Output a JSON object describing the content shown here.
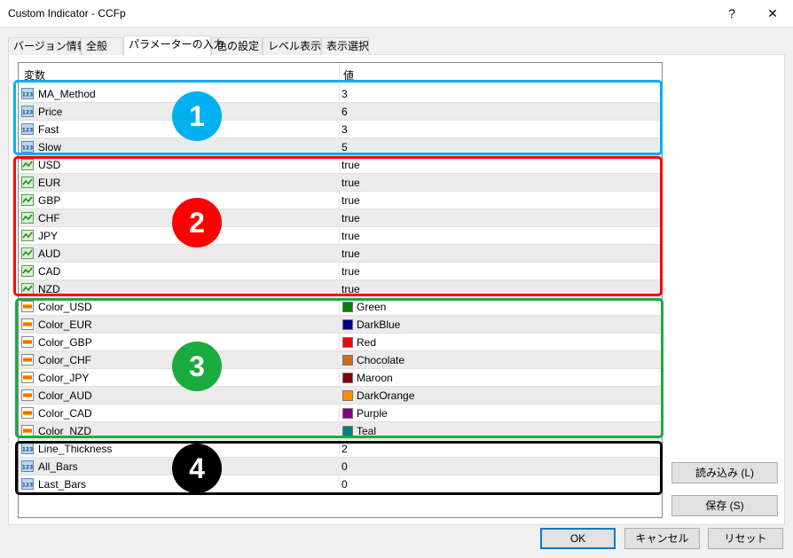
{
  "window": {
    "title": "Custom Indicator - CCFp",
    "help_label": "?",
    "close_label": "✕"
  },
  "tabs": [
    {
      "label": "バージョン情報"
    },
    {
      "label": "全般"
    },
    {
      "label": "パラメーターの入力"
    },
    {
      "label": "色の設定"
    },
    {
      "label": "レベル表示"
    },
    {
      "label": "表示選択"
    }
  ],
  "active_tab": "パラメーターの入力",
  "table": {
    "headers": {
      "variable": "変数",
      "value": "値"
    },
    "rows": [
      {
        "type": "int",
        "name": "MA_Method",
        "value": "3"
      },
      {
        "type": "int",
        "name": "Price",
        "value": "6"
      },
      {
        "type": "int",
        "name": "Fast",
        "value": "3"
      },
      {
        "type": "int",
        "name": "Slow",
        "value": "5"
      },
      {
        "type": "bool",
        "name": "USD",
        "value": "true"
      },
      {
        "type": "bool",
        "name": "EUR",
        "value": "true"
      },
      {
        "type": "bool",
        "name": "GBP",
        "value": "true"
      },
      {
        "type": "bool",
        "name": "CHF",
        "value": "true"
      },
      {
        "type": "bool",
        "name": "JPY",
        "value": "true"
      },
      {
        "type": "bool",
        "name": "AUD",
        "value": "true"
      },
      {
        "type": "bool",
        "name": "CAD",
        "value": "true"
      },
      {
        "type": "bool",
        "name": "NZD",
        "value": "true"
      },
      {
        "type": "color",
        "name": "Color_USD",
        "value": "Green",
        "swatch": "#008000"
      },
      {
        "type": "color",
        "name": "Color_EUR",
        "value": "DarkBlue",
        "swatch": "#00008b"
      },
      {
        "type": "color",
        "name": "Color_GBP",
        "value": "Red",
        "swatch": "#ff0000"
      },
      {
        "type": "color",
        "name": "Color_CHF",
        "value": "Chocolate",
        "swatch": "#d2691e"
      },
      {
        "type": "color",
        "name": "Color_JPY",
        "value": "Maroon",
        "swatch": "#800000"
      },
      {
        "type": "color",
        "name": "Color_AUD",
        "value": "DarkOrange",
        "swatch": "#ff8c00"
      },
      {
        "type": "color",
        "name": "Color_CAD",
        "value": "Purple",
        "swatch": "#800080"
      },
      {
        "type": "color",
        "name": "Color_NZD",
        "value": "Teal",
        "swatch": "#008080"
      },
      {
        "type": "int",
        "name": "Line_Thickness",
        "value": "2"
      },
      {
        "type": "int",
        "name": "All_Bars",
        "value": "0"
      },
      {
        "type": "int",
        "name": "Last_Bars",
        "value": "0"
      }
    ]
  },
  "annotations": [
    {
      "label": "1",
      "color": "#00b0f0"
    },
    {
      "label": "2",
      "color": "#ff0000"
    },
    {
      "label": "3",
      "color": "#1aab40"
    },
    {
      "label": "4",
      "color": "#000000"
    }
  ],
  "buttons": {
    "load": "読み込み (L)",
    "save": "保存 (S)",
    "ok": "OK",
    "cancel": "キャンセル",
    "reset": "リセット"
  }
}
